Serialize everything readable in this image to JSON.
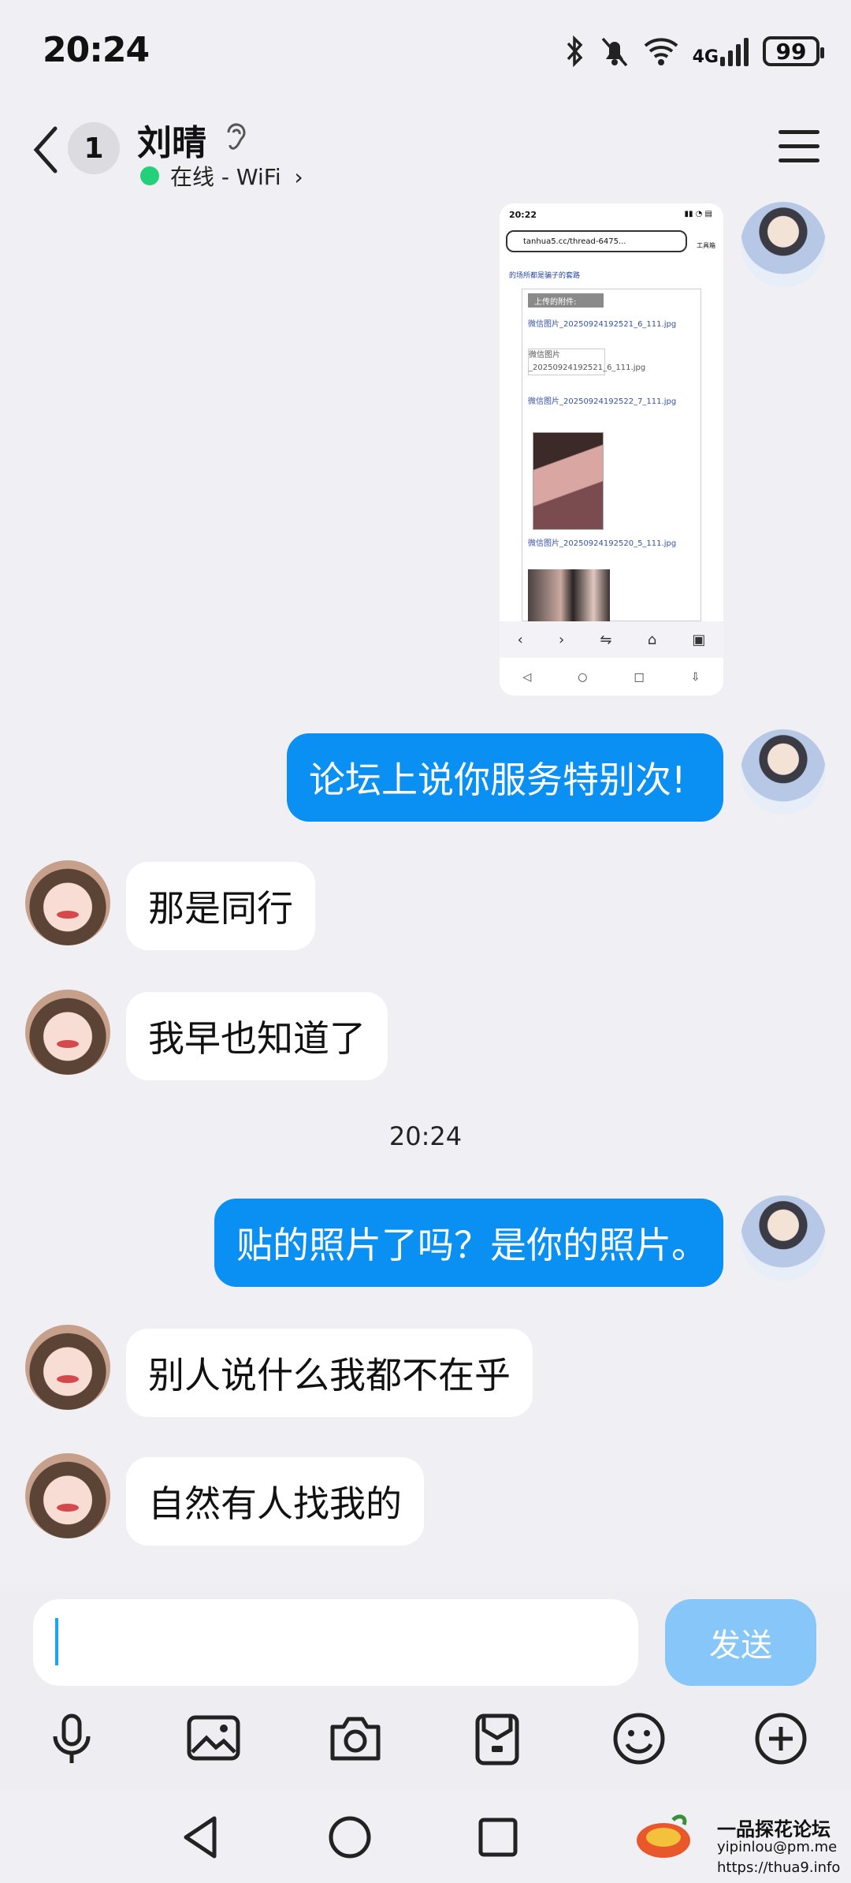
{
  "status_bar": {
    "time": "20:24",
    "network": "4G",
    "battery": "99"
  },
  "header": {
    "unread_count": "1",
    "contact_name": "刘晴",
    "online_status": "在线 - WiFi"
  },
  "screenshot_message": {
    "time": "20:22",
    "url": "tanhua5.cc/thread-6475...",
    "intro_text": "的场所都是骗子的套路",
    "attachments_label": "上传的附件:",
    "file1": "微信图片_20250924192521_6_111.jpg",
    "file1_alt": "微信图片_20250924192521_6_111.jpg",
    "file2": "微信图片_20250924192522_7_111.jpg",
    "file3": "微信图片_20250924192520_5_111.jpg",
    "toolbox_label": "工具箱"
  },
  "messages": [
    {
      "direction": "outgoing",
      "text": "论坛上说你服务特别次!"
    },
    {
      "direction": "incoming",
      "text": "那是同行"
    },
    {
      "direction": "incoming",
      "text": "我早也知道了"
    },
    {
      "direction": "outgoing",
      "text": "贴的照片了吗？是你的照片。"
    },
    {
      "direction": "incoming",
      "text": "别人说什么我都不在乎"
    },
    {
      "direction": "incoming",
      "text": "自然有人找我的"
    }
  ],
  "time_divider": "20:24",
  "input": {
    "value": "",
    "send_label": "发送"
  },
  "toolbar_icons": [
    "microphone-icon",
    "image-icon",
    "camera-icon",
    "folder-icon",
    "emoji-icon",
    "plus-icon"
  ],
  "watermark": {
    "title": "一品探花论坛",
    "email": "yipinlou@pm.me",
    "url": "https://thua9.info"
  },
  "colors": {
    "background": "#efeff4",
    "outgoing_bubble": "#0a8ff2",
    "incoming_bubble": "#ffffff",
    "send_button": "#86c6f8",
    "online": "#22d17a"
  }
}
